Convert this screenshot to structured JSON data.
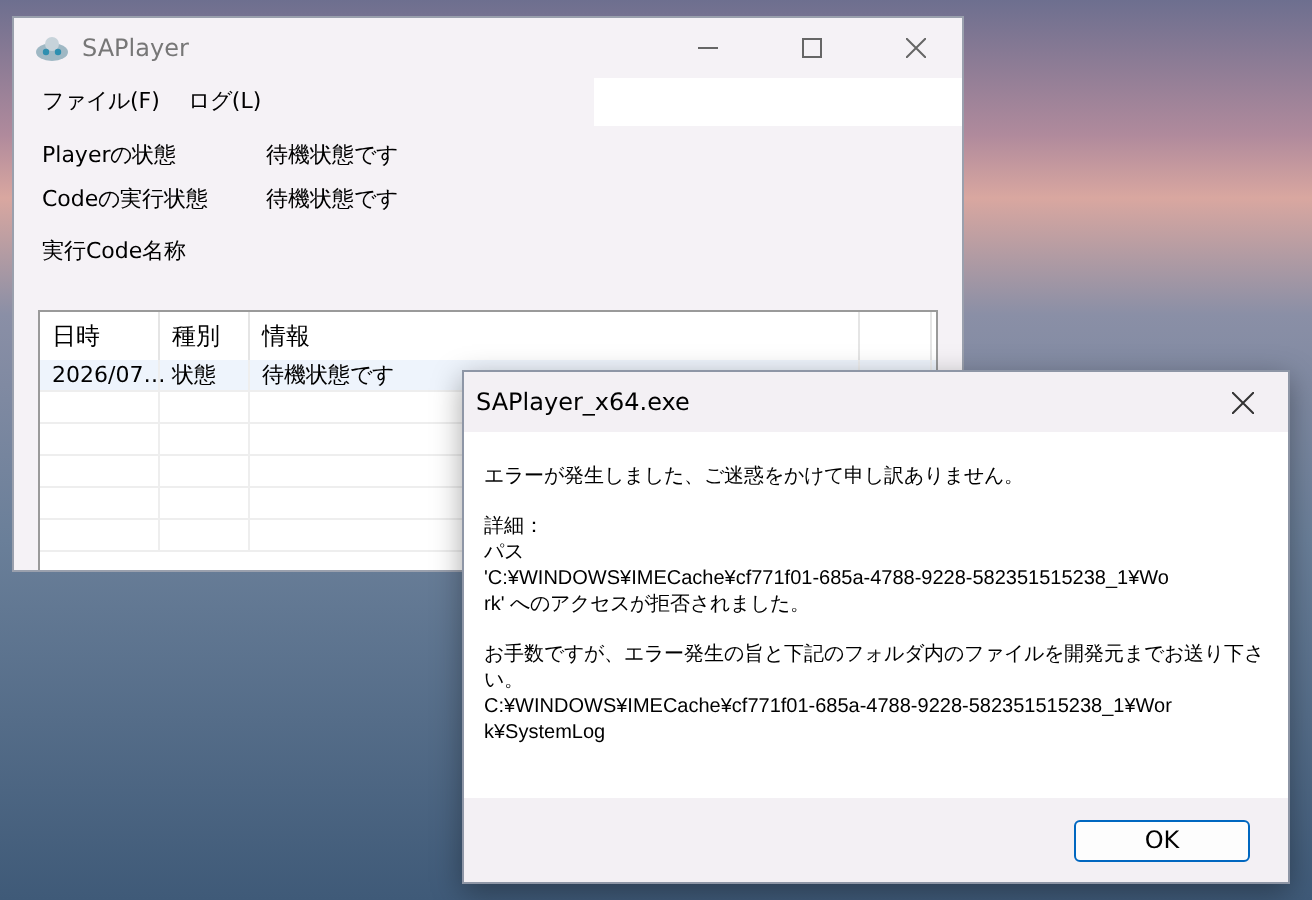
{
  "main_window": {
    "title": "SAPlayer",
    "menu": [
      {
        "label": "ファイル(F)"
      },
      {
        "label": "ログ(L)"
      }
    ],
    "status_fields": [
      {
        "label": "Playerの状態",
        "value": "待機状態です"
      },
      {
        "label": "Codeの実行状態",
        "value": "待機状態です"
      },
      {
        "label": "実行Code名称"
      }
    ],
    "table": {
      "columns": [
        "日時",
        "種別",
        "情報"
      ],
      "rows": [
        [
          "2026/07…",
          "状態",
          "待機状態です"
        ]
      ]
    }
  },
  "dialog": {
    "title": "SAPlayer_x64.exe",
    "paragraphs": [
      [
        "エラーが発生しました、ご迷惑をかけて申し訳ありません。"
      ],
      [
        "詳細：",
        "パス",
        "'C:¥WINDOWS¥IMECache¥cf771f01-685a-4788-9228-582351515238_1¥Wo",
        "rk' へのアクセスが拒否されました。"
      ],
      [
        "お手数ですが、エラー発生の旨と下記のフォルダ内のファイルを開発元までお送り下さ",
        "い。",
        "C:¥WINDOWS¥IMECache¥cf771f01-685a-4788-9228-582351515238_1¥Wor",
        "k¥SystemLog"
      ]
    ],
    "buttons": [
      "OK"
    ]
  }
}
